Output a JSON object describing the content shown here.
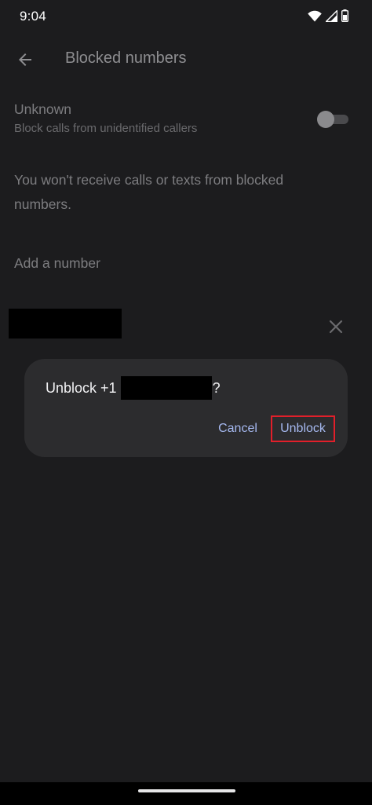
{
  "status_bar": {
    "time": "9:04",
    "icons": [
      "wifi-icon",
      "signal-icon",
      "battery-icon"
    ]
  },
  "app_bar": {
    "back_icon": "arrow-back-icon",
    "title": "Blocked numbers"
  },
  "unknown_setting": {
    "title": "Unknown",
    "subtitle": "Block calls from unidentified callers",
    "toggle_on": false
  },
  "info_text": "You won't receive calls or texts from blocked numbers.",
  "add_number_label": "Add a number",
  "blocked_list": {
    "remove_icon": "close-icon"
  },
  "dialog": {
    "title_prefix": "Unblock +1",
    "title_suffix": "?",
    "cancel_label": "Cancel",
    "unblock_label": "Unblock"
  },
  "colors": {
    "background": "#1c1c1e",
    "dialog_background": "#2c2c2e",
    "accent_text": "#a6b9f0",
    "highlight_border": "#e21f2a"
  }
}
